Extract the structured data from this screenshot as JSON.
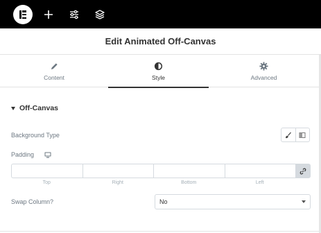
{
  "topbar": {
    "icons": [
      "elementor-logo-icon",
      "plus-icon",
      "sliders-icon",
      "layers-icon"
    ]
  },
  "header": {
    "title": "Edit Animated Off-Canvas"
  },
  "tabs": [
    {
      "label": "Content",
      "icon": "pencil-icon"
    },
    {
      "label": "Style",
      "icon": "half-circle-icon",
      "active": true
    },
    {
      "label": "Advanced",
      "icon": "gear-icon"
    }
  ],
  "section": {
    "title": "Off-Canvas"
  },
  "background_type": {
    "label": "Background Type",
    "options": [
      "brush-icon",
      "gradient-icon"
    ]
  },
  "padding": {
    "label": "Padding",
    "device_icon": "desktop-icon",
    "values": {
      "top": "",
      "right": "",
      "bottom": "",
      "left": ""
    },
    "sublabels": [
      "Top",
      "Right",
      "Bottom",
      "Left"
    ],
    "link_icon": "link-icon"
  },
  "swap_column": {
    "label": "Swap Column?",
    "value": "No"
  },
  "colors": {
    "topbar_bg": "#000000",
    "text_main": "#333333",
    "text_muted": "#6d7882",
    "border": "#d5dadf"
  }
}
